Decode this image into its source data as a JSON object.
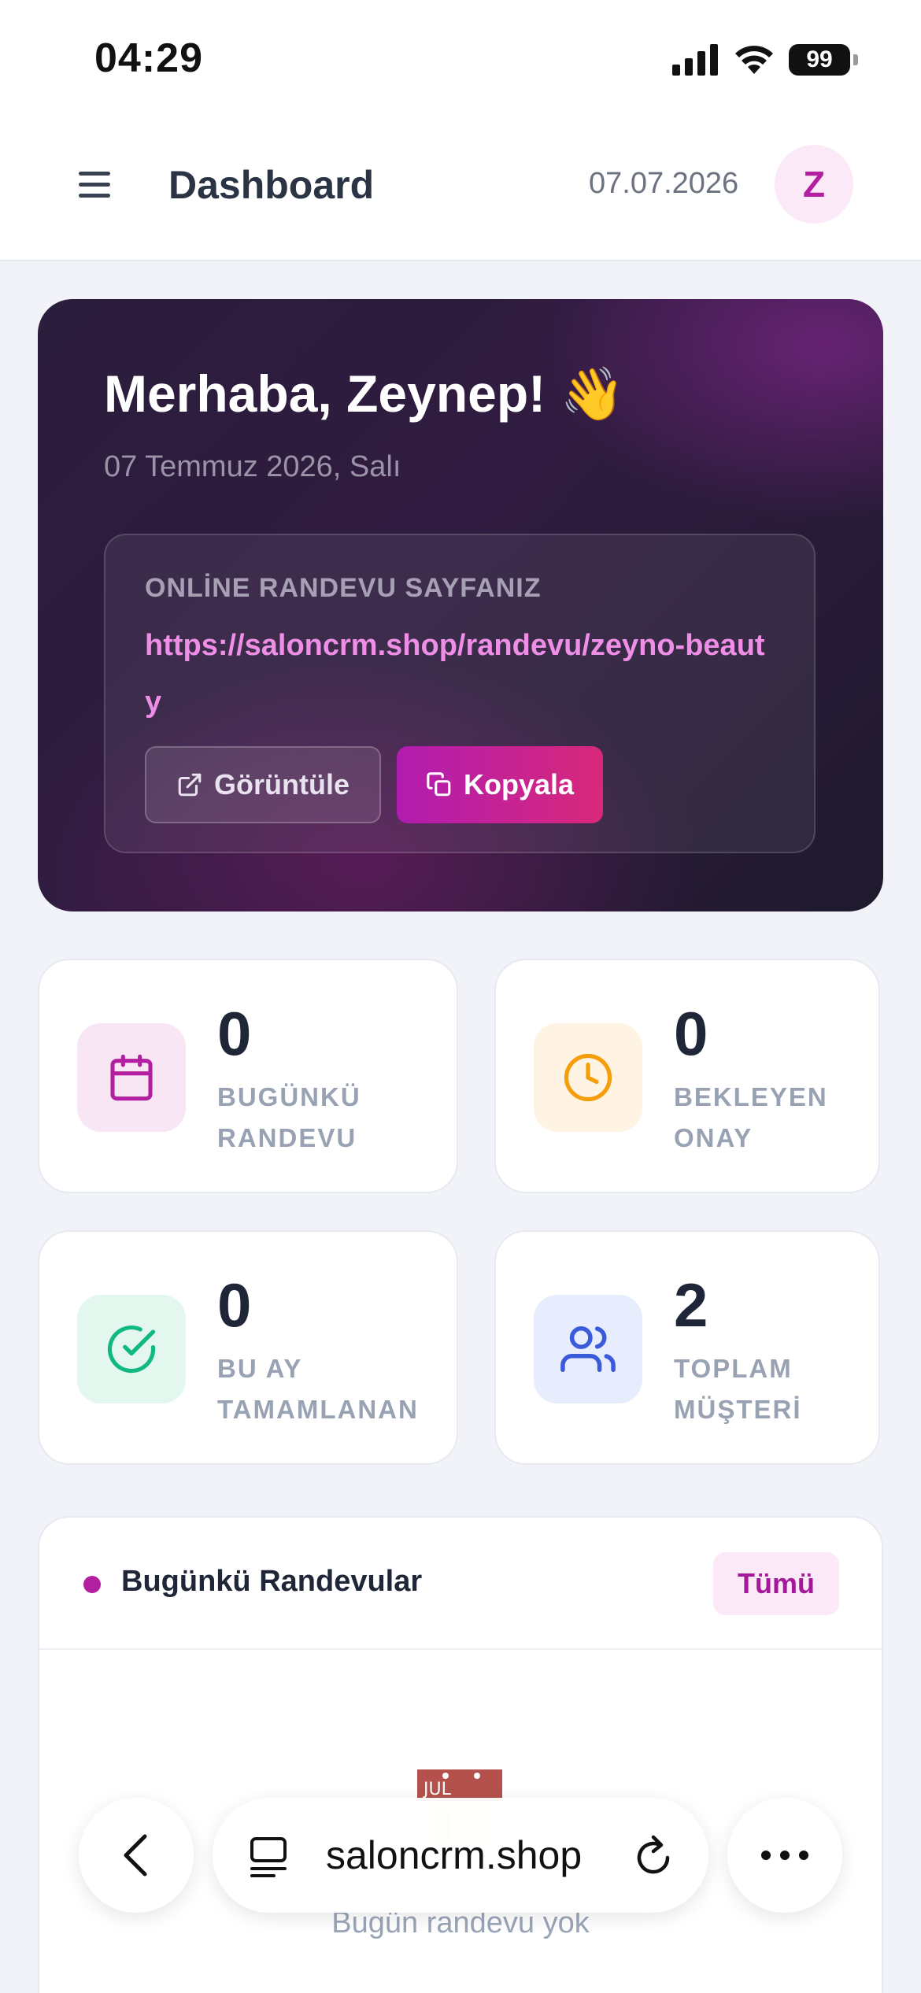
{
  "status_bar": {
    "time": "04:29",
    "battery": "99"
  },
  "header": {
    "title": "Dashboard",
    "date": "07.07.2026",
    "avatar_initial": "Z"
  },
  "hero": {
    "greeting": "Merhaba, Zeynep! 👋",
    "date": "07 Temmuz 2026, Salı",
    "link_label": "ONLİNE RANDEVU SAYFANIZ",
    "link_url": "https://saloncrm.shop/randevu/zeyno-beauty",
    "view_button": "Görüntüle",
    "copy_button": "Kopyala"
  },
  "stats": [
    {
      "value": "0",
      "label": "BUGÜNKÜ RANDEVU",
      "icon": "calendar-icon",
      "color": "#b21fa0"
    },
    {
      "value": "0",
      "label": "BEKLEYEN ONAY",
      "icon": "clock-icon",
      "color": "#f59e0b"
    },
    {
      "value": "0",
      "label": "BU AY TAMAMLANAN",
      "icon": "check-circle-icon",
      "color": "#10b981"
    },
    {
      "value": "2",
      "label": "TOPLAM MÜŞTERİ",
      "icon": "users-icon",
      "color": "#3b5bdb"
    }
  ],
  "appointments": {
    "title": "Bugünkü Randevular",
    "all_button": "Tümü",
    "calendar_month": "JUL",
    "empty_text": "Bugün randevu yok"
  },
  "browser": {
    "url": "saloncrm.shop"
  }
}
